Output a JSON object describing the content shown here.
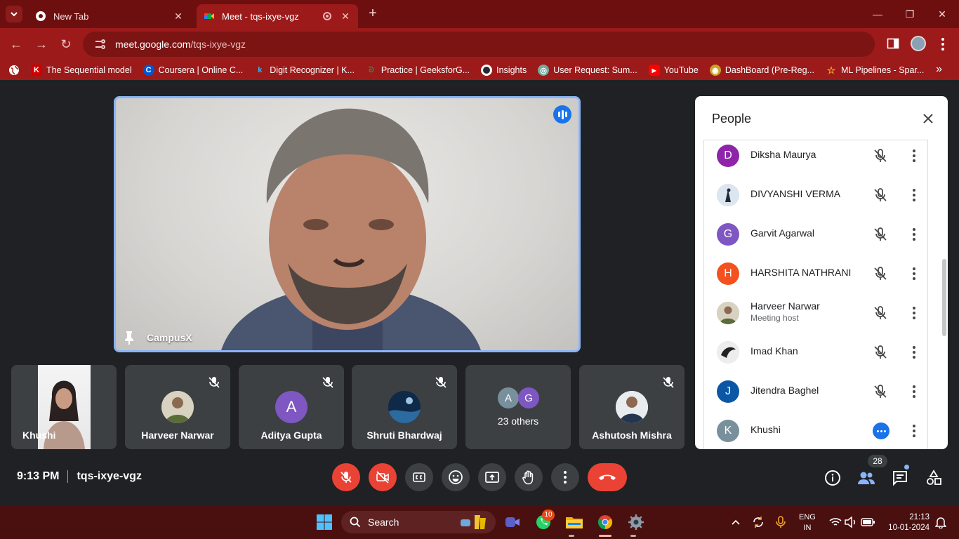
{
  "browser": {
    "tabs": [
      {
        "title": "New Tab",
        "active": false
      },
      {
        "title": "Meet - tqs-ixye-vgz",
        "active": true
      }
    ],
    "url": {
      "host": "meet.google.com",
      "path": "/tqs-ixye-vgz"
    },
    "bookmarks": [
      {
        "label": "The Sequential model",
        "icon": "keras-icon",
        "color": "#d00000",
        "glyph": "K"
      },
      {
        "label": "Coursera | Online C...",
        "icon": "coursera-icon",
        "color": "#0056d2",
        "glyph": "C"
      },
      {
        "label": "Digit Recognizer | K...",
        "icon": "kaggle-icon",
        "color": "#20beff",
        "glyph": "k"
      },
      {
        "label": "Practice | GeeksforG...",
        "icon": "geeksforgeeks-icon",
        "color": "#2f8d46",
        "glyph": "ᘐ"
      },
      {
        "label": "Insights",
        "icon": "github-icon",
        "color": "#ffffff",
        "glyph": ""
      },
      {
        "label": "User Request: Sum...",
        "icon": "chatgpt-icon",
        "color": "#74aa9c",
        "glyph": "◎"
      },
      {
        "label": "YouTube",
        "icon": "youtube-icon",
        "color": "#ff0000",
        "glyph": "▶"
      },
      {
        "label": "DashBoard (Pre-Reg...",
        "icon": "dashboard-icon",
        "color": "#c9a227",
        "glyph": "◉"
      },
      {
        "label": "ML Pipelines - Spar...",
        "icon": "spark-icon",
        "color": "#e25a1c",
        "glyph": "☆"
      }
    ]
  },
  "meet": {
    "main_speaker": {
      "name": "CampusX"
    },
    "tiles": [
      {
        "name": "Khushi",
        "muted": false,
        "kind": "video"
      },
      {
        "name": "Harveer Narwar",
        "muted": true,
        "kind": "photo"
      },
      {
        "name": "Aditya Gupta",
        "muted": true,
        "kind": "letter",
        "letter": "A",
        "color": "#7e57c2"
      },
      {
        "name": "Shruti Bhardwaj",
        "muted": true,
        "kind": "photo"
      },
      {
        "name": "23 others",
        "muted": false,
        "kind": "group",
        "avatars": [
          {
            "letter": "A",
            "color": "#78909c"
          },
          {
            "letter": "G",
            "color": "#7e57c2"
          }
        ]
      },
      {
        "name": "Ashutosh Mishra",
        "muted": true,
        "kind": "photo"
      }
    ],
    "people_panel": {
      "title": "People",
      "participants": [
        {
          "name": "Diksha Maurya",
          "avatar": "D",
          "color": "#8e24aa",
          "status": "muted"
        },
        {
          "name": "DIVYANSHI VERMA",
          "avatar": "",
          "color": "#b3c7d6",
          "status": "muted"
        },
        {
          "name": "Garvit Agarwal",
          "avatar": "G",
          "color": "#7e57c2",
          "status": "muted"
        },
        {
          "name": "HARSHITA NATHRANI",
          "avatar": "H",
          "color": "#f4511e",
          "status": "muted"
        },
        {
          "name": "Harveer Narwar",
          "role": "Meeting host",
          "avatar": "",
          "color": "#8d7b63",
          "status": "muted"
        },
        {
          "name": "Imad Khan",
          "avatar": "",
          "color": "#e0e0e0",
          "status": "muted"
        },
        {
          "name": "Jitendra Baghel",
          "avatar": "J",
          "color": "#0b57a6",
          "status": "muted"
        },
        {
          "name": "Khushi",
          "avatar": "K",
          "color": "#78909c",
          "status": "speaking"
        }
      ]
    },
    "footer": {
      "time": "9:13 PM",
      "meeting_code": "tqs-ixye-vgz",
      "people_count": "28"
    }
  },
  "taskbar": {
    "search_placeholder": "Search",
    "whatsapp_badge": "10",
    "language": {
      "line1": "ENG",
      "line2": "IN"
    },
    "clock": {
      "time": "21:13",
      "date": "10-01-2024"
    }
  }
}
